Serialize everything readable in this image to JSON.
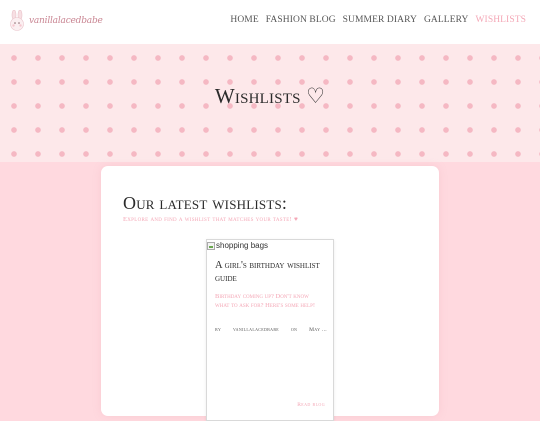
{
  "header": {
    "logo_text": "vanillalacedbabe",
    "nav": [
      "HOME",
      "FASHION BLOG",
      "SUMMER DIARY",
      "GALLERY",
      "WISHLISTS"
    ]
  },
  "hero": {
    "title": "Wishlists ♡"
  },
  "main": {
    "title": "Our latest wishlists:",
    "subtitle": "Explore and find a wishlist that matches your taste! ♥",
    "post": {
      "image_alt": "shopping bags",
      "title": "A girl's birthday wishlist guide",
      "excerpt": "Birthday coming up? Don't know what to ask for? Here's some help!",
      "meta_by": "by",
      "meta_author": "vanillalacedbabe",
      "meta_on": "on",
      "meta_date": "May ...",
      "read_more": "Read blog"
    }
  },
  "colors": {
    "accent": "#f4a7b6",
    "background": "#ffd9df",
    "hero_bg": "#fde8ea",
    "dot": "#f5b8c3"
  }
}
